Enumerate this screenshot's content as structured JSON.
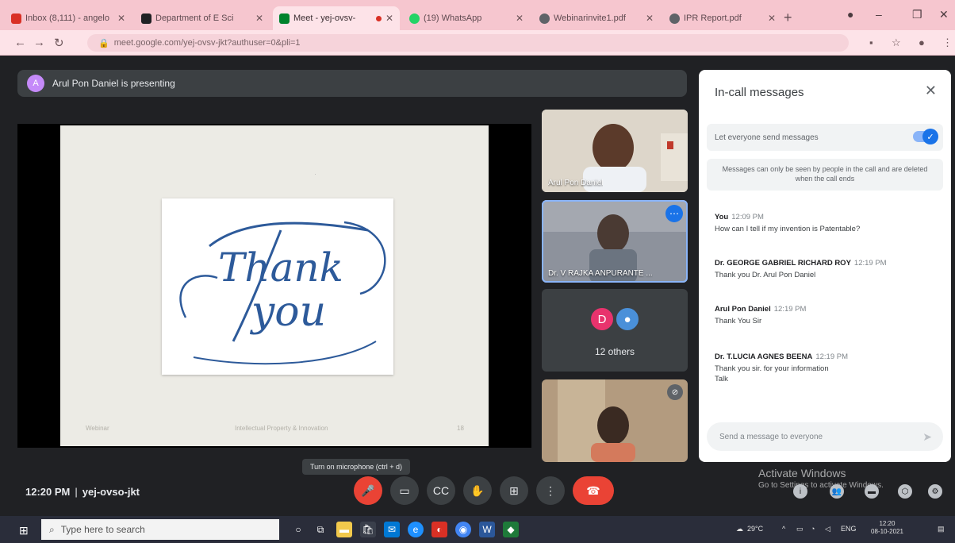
{
  "browser": {
    "tabs": [
      {
        "title": "Inbox (8,111) - angelo",
        "active": false,
        "favicon_color": "#d93025"
      },
      {
        "title": "Department of E Sci",
        "active": false,
        "favicon_color": "#202124"
      },
      {
        "title": "Meet - yej-ovsv-",
        "active": true,
        "favicon_color": "#00832d"
      },
      {
        "title": "(19) WhatsApp",
        "active": false,
        "favicon_color": "#25d366"
      },
      {
        "title": "Webinarinvite1.pdf",
        "active": false,
        "favicon_color": "#5f6368"
      },
      {
        "title": "IPR Report.pdf",
        "active": false,
        "favicon_color": "#5f6368"
      }
    ],
    "url": "meet.google.com/yej-ovsv-jkt?authuser=0&pli=1"
  },
  "meet": {
    "presenter_banner": "Arul Pon Daniel is presenting",
    "presenter_initial": "A",
    "slide": {
      "card_text_line1": "Thank",
      "card_text_line2": "you",
      "footer_left": "Webinar",
      "footer_center": "Intellectual Property & Innovation",
      "footer_right": "18"
    },
    "tiles": [
      {
        "name": "Arul Pon Daniel"
      },
      {
        "name": "Dr. V RAJKA ANPURANTE ..."
      },
      {
        "others_initial": "D",
        "others_label": "12 others"
      },
      {
        "name": ""
      }
    ],
    "meeting_time": "12:20 PM",
    "meeting_code": "yej-ovso-jkt",
    "tooltip": "Turn on microphone (ctrl + d)",
    "activate_line1": "Activate Windows",
    "activate_line2": "Go to Settings to activate Windows."
  },
  "chat": {
    "title": "In-call messages",
    "allow_label": "Let everyone send messages",
    "notice": "Messages can only be seen by people in the call and are deleted when the call ends",
    "messages": [
      {
        "sender": "You",
        "time": "12:09 PM",
        "lines": [
          "How can I tell if my invention is Patentable?"
        ]
      },
      {
        "sender": "Dr. GEORGE GABRIEL RICHARD ROY",
        "time": "12:19 PM",
        "lines": [
          "Thank you Dr. Arul Pon Daniel"
        ]
      },
      {
        "sender": "Arul Pon Daniel",
        "time": "12:19 PM",
        "lines": [
          "Thank You Sir"
        ]
      },
      {
        "sender": "Dr. T.LUCIA AGNES BEENA",
        "time": "12:19 PM",
        "lines": [
          "Thank you sir. for your information",
          "Talk"
        ]
      }
    ],
    "input_placeholder": "Send a message to everyone"
  },
  "taskbar": {
    "search_placeholder": "Type here to search",
    "weather": "29°C",
    "lang": "ENG",
    "time": "12:20",
    "date": "08-10-2021"
  },
  "colors": {
    "meet_bg": "#202124",
    "accent": "#1a73e8",
    "end_call": "#ea4335",
    "tab_strip": "#f6c6cf"
  }
}
